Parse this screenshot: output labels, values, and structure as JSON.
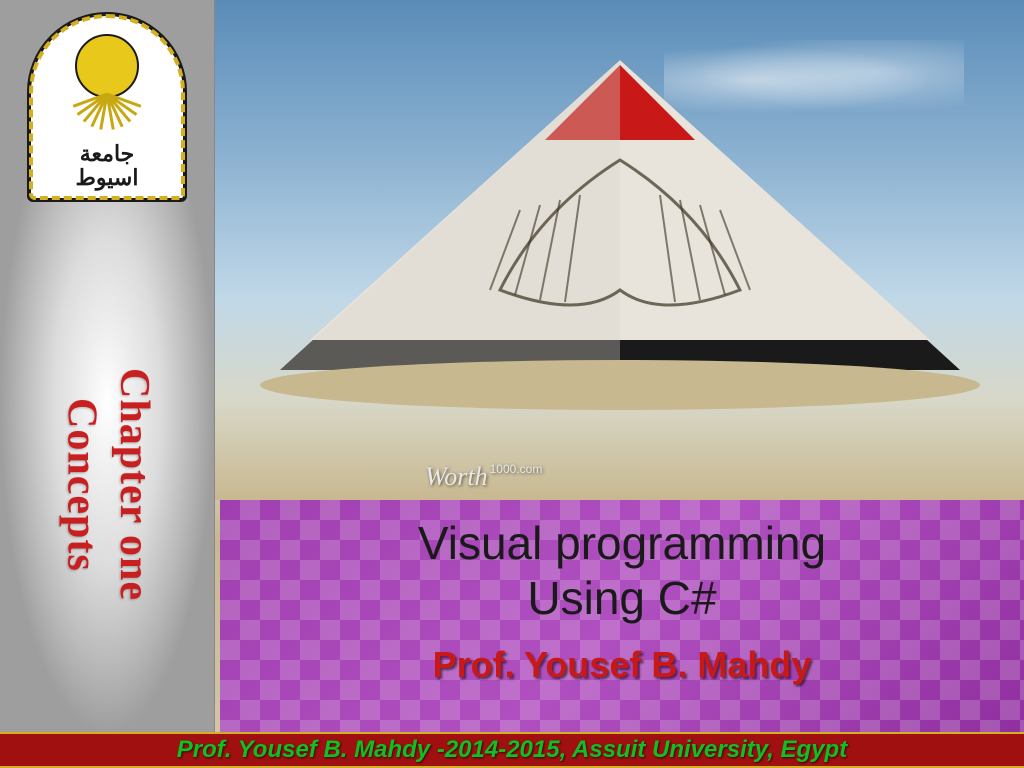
{
  "sidebar": {
    "logo_arabic_top": "جامعة",
    "logo_arabic_bottom": "اسيوط",
    "chapter_label": "Chapter one\nConcepts"
  },
  "main": {
    "watermark_brand": "Worth",
    "watermark_site": "1000.com"
  },
  "title": {
    "line1": "Visual programming",
    "line2": "Using C#",
    "author": "Prof. Yousef B. Mahdy"
  },
  "footer": {
    "text": "Prof. Yousef B. Mahdy -2014-2015, Assuit University, Egypt"
  }
}
